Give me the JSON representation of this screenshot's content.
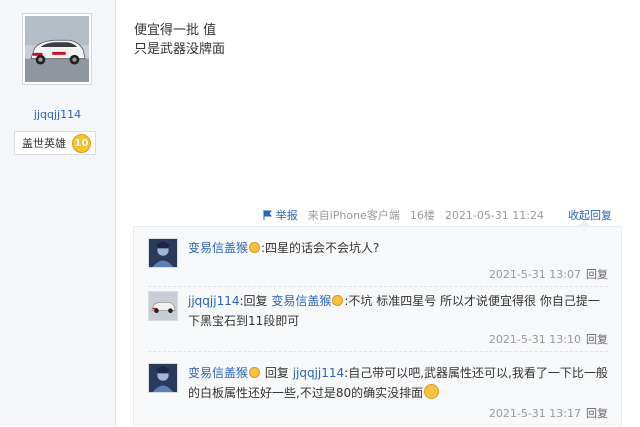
{
  "author": {
    "username": "jjqqjj114",
    "badge_title": "盖世英雄",
    "badge_level": "10"
  },
  "post": {
    "lines": [
      "便宜得一批 值",
      "只是武器没牌面"
    ],
    "report_label": "举报",
    "source": "来自iPhone客户端",
    "floor": "16楼",
    "datetime": "2021-05-31 11:24",
    "collapse_reply_label": "收起回复"
  },
  "replies": [
    {
      "user": "变易信盖猴",
      "text": ":四星的话会不会坑人?",
      "time": "2021-5-31 13:07",
      "reply_label": "回复"
    },
    {
      "user": "jjqqjj114",
      "reply_word": ":回复",
      "target": "变易信盖猴",
      "text": ":不坑 标准四星号 所以才说便宜得很 你自己提一下黑宝石到11段即可",
      "time": "2021-5-31 13:10",
      "reply_label": "回复"
    },
    {
      "user": "变易信盖猴",
      "reply_word": "回复",
      "target": "jjqqjj114",
      "text": ":自己带可以吧,武器属性还可以,我看了一下比一般的白板属性还好一些,不过是80的确实没排面",
      "time": "2021-5-31 13:17",
      "reply_label": "回复"
    }
  ],
  "colors": {
    "link": "#2d64b3",
    "meta": "#999999",
    "sidebar_bg": "#f4f6f9"
  }
}
